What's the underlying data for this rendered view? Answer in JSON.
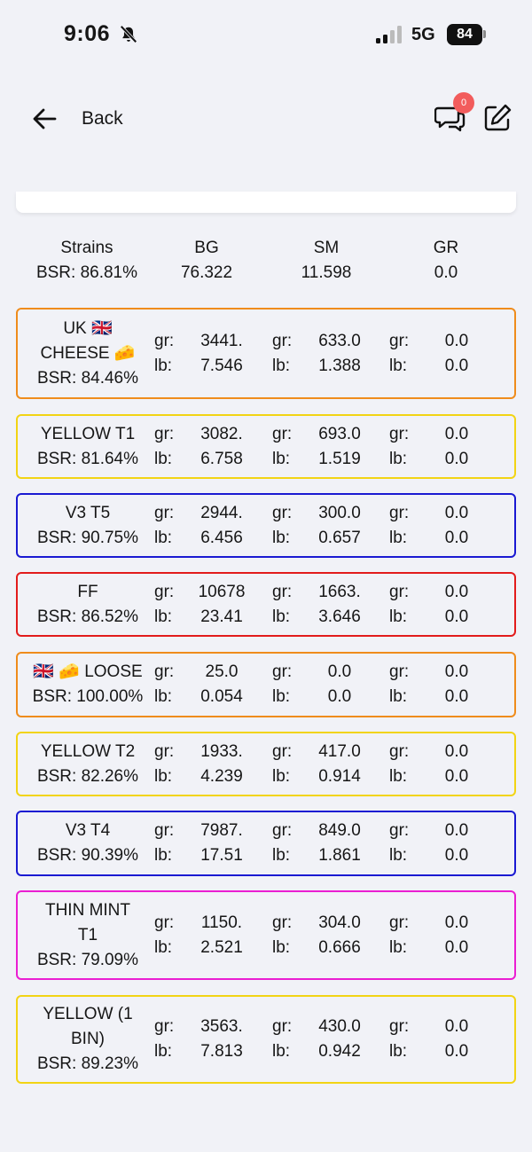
{
  "status": {
    "time": "9:06",
    "network": "5G",
    "battery": "84"
  },
  "header": {
    "back_label": "Back",
    "chat_badge": "0"
  },
  "summary": {
    "strains_label": "Strains",
    "bsr": "BSR: 86.81%",
    "cols": [
      {
        "label": "BG",
        "value": "76.322"
      },
      {
        "label": "SM",
        "value": "11.598"
      },
      {
        "label": "GR",
        "value": "0.0"
      }
    ]
  },
  "unit_labels": {
    "gr": "gr:",
    "lb": "lb:"
  },
  "colors": {
    "orange": "#ef8c1c",
    "yellow": "#f2d414",
    "blue": "#1a1ad2",
    "red": "#e21c1c",
    "magenta": "#ea1ed2"
  },
  "rows": [
    {
      "name_lines": [
        "UK 🇬🇧",
        "CHEESE 🧀",
        "BSR: 84.46%"
      ],
      "color": "orange",
      "bg_gr": "3441.",
      "bg_lb": "7.546",
      "sm_gr": "633.0",
      "sm_lb": "1.388",
      "gr_gr": "0.0",
      "gr_lb": "0.0"
    },
    {
      "name_lines": [
        "YELLOW T1",
        "BSR: 81.64%"
      ],
      "color": "yellow",
      "bg_gr": "3082.",
      "bg_lb": "6.758",
      "sm_gr": "693.0",
      "sm_lb": "1.519",
      "gr_gr": "0.0",
      "gr_lb": "0.0"
    },
    {
      "name_lines": [
        "V3 T5",
        "BSR: 90.75%"
      ],
      "color": "blue",
      "bg_gr": "2944.",
      "bg_lb": "6.456",
      "sm_gr": "300.0",
      "sm_lb": "0.657",
      "gr_gr": "0.0",
      "gr_lb": "0.0"
    },
    {
      "name_lines": [
        "FF",
        "BSR: 86.52%"
      ],
      "color": "red",
      "bg_gr": "10678",
      "bg_lb": "23.41",
      "sm_gr": "1663.",
      "sm_lb": "3.646",
      "gr_gr": "0.0",
      "gr_lb": "0.0"
    },
    {
      "name_lines": [
        "🇬🇧 🧀 LOOSE",
        "BSR: 100.00%"
      ],
      "color": "orange",
      "bg_gr": "25.0",
      "bg_lb": "0.054",
      "sm_gr": "0.0",
      "sm_lb": "0.0",
      "gr_gr": "0.0",
      "gr_lb": "0.0"
    },
    {
      "name_lines": [
        "YELLOW T2",
        "BSR: 82.26%"
      ],
      "color": "yellow",
      "bg_gr": "1933.",
      "bg_lb": "4.239",
      "sm_gr": "417.0",
      "sm_lb": "0.914",
      "gr_gr": "0.0",
      "gr_lb": "0.0"
    },
    {
      "name_lines": [
        "V3 T4",
        "BSR: 90.39%"
      ],
      "color": "blue",
      "bg_gr": "7987.",
      "bg_lb": "17.51",
      "sm_gr": "849.0",
      "sm_lb": "1.861",
      "gr_gr": "0.0",
      "gr_lb": "0.0"
    },
    {
      "name_lines": [
        "THIN MINT",
        "T1",
        "BSR: 79.09%"
      ],
      "color": "magenta",
      "bg_gr": "1150.",
      "bg_lb": "2.521",
      "sm_gr": "304.0",
      "sm_lb": "0.666",
      "gr_gr": "0.0",
      "gr_lb": "0.0"
    },
    {
      "name_lines": [
        "YELLOW (1",
        "BIN)",
        "BSR: 89.23%"
      ],
      "color": "yellow",
      "bg_gr": "3563.",
      "bg_lb": "7.813",
      "sm_gr": "430.0",
      "sm_lb": "0.942",
      "gr_gr": "0.0",
      "gr_lb": "0.0"
    }
  ]
}
